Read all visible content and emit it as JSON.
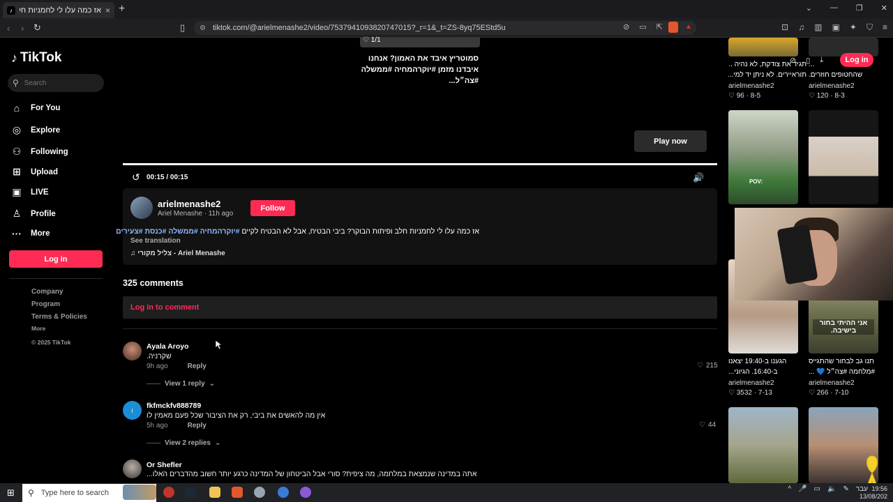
{
  "browser": {
    "tab_title": "אז כמה עלו לי לחמניות חלב ופית...",
    "tab_close": "×",
    "new_tab": "+",
    "url": "tiktok.com/@arielmenashe2/video/7537941093820747015?_r=1&_t=ZS-8yq75EStd5u"
  },
  "sidebar": {
    "logo": "TikTok",
    "search_placeholder": "Search",
    "nav": [
      {
        "label": "For You",
        "icon": "home-icon"
      },
      {
        "label": "Explore",
        "icon": "compass-icon"
      },
      {
        "label": "Following",
        "icon": "following-icon"
      },
      {
        "label": "Upload",
        "icon": "upload-icon"
      },
      {
        "label": "LIVE",
        "icon": "live-icon"
      },
      {
        "label": "Profile",
        "icon": "profile-icon"
      },
      {
        "label": "More",
        "icon": "more-icon"
      }
    ],
    "login": "Log in",
    "footer": {
      "company": "Company",
      "program": "Program",
      "terms": "Terms & Policies",
      "more": "More",
      "copyright": "© 2025 TikTok"
    }
  },
  "video": {
    "likes_overlay": "1/1",
    "caption": "סמוטריץ איבד את האמון? אנחנו איבדנו מזמן #יוקרהמחיה #ממשלה #צה״ל...",
    "play_now": "Play now",
    "time": "00:15 / 00:15"
  },
  "author": {
    "handle": "arielmenashe2",
    "sub": "Ariel Menashe · 11h ago",
    "follow": "Follow",
    "desc_text": "אז כמה עלו לי לחמניות חלב ופיתות הבוקר? ביבי הבטיח, אבל לא הבטיח לקיים",
    "desc_tags": "#יוקרהמחיה #ממשלה #כנסת #צעירים",
    "see_translation": "See translation",
    "music": "♫ צליל מקורי - Ariel Menashe"
  },
  "comments": {
    "count": "325 comments",
    "login_prompt": "Log in to comment",
    "items": [
      {
        "name": "Ayala Aroyo",
        "text": "שקרניה.",
        "time": "9h ago",
        "reply": "Reply",
        "likes": "215",
        "view_replies": "View 1 reply"
      },
      {
        "name": "fkfmckfv888789",
        "text": "אין מה להאשים את ביבי, רק את הציבור שכל פעם מאמין לו",
        "time": "5h ago",
        "reply": "Reply",
        "likes": "44",
        "view_replies": "View 2 replies"
      },
      {
        "name": "Or Shefler",
        "text": "אתה במדינה שנמצאת במלחמה, מה ציפית? סורי אבל הביטחון של המדינה כרגע יותר חשוב מהדברים האלו...",
        "time": "",
        "reply": "",
        "likes": "",
        "view_replies": ""
      }
    ]
  },
  "right_column": {
    "overlay_login": "Log in",
    "tiles": [
      {
        "caption": "תגיד את צודקת, לא נהיה ...",
        "caption2": "תוראיירים. לא ניתן יד למי...",
        "user": "arielmenashe2",
        "likes": "96",
        "date": "8-5"
      },
      {
        "caption": "...",
        "caption2": "שהחטופים חוזרים.",
        "user": "arielmenashe2",
        "likes": "120",
        "date": "8-3"
      },
      {
        "caption": "הגענו ב-19:40 יצאנו",
        "caption2": "ב-16:40. הגיוני...",
        "user": "arielmenashe2",
        "likes": "3532",
        "date": "7-13"
      },
      {
        "caption": "תנו גב לבחור שהתגייס",
        "caption2": "#מלחמה #צה״ל 💙 ...",
        "user": "arielmenashe2",
        "likes": "266",
        "date": "7-10"
      }
    ],
    "tile_text_pov": "POV:",
    "tile_text_yeshiva": "אני ההיתי בחור בישיבה."
  },
  "taskbar": {
    "search_placeholder": "Type here to search",
    "lang": "עבר",
    "time": "19:56",
    "date": "13/08/202"
  },
  "colors": {
    "accent": "#fe2c55",
    "hashtag": "#8fb6ff",
    "background": "#000000"
  }
}
